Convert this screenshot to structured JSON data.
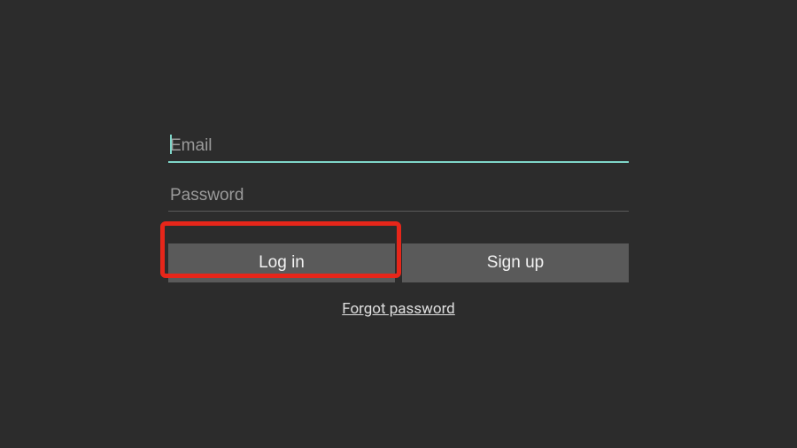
{
  "form": {
    "email_placeholder": "Email",
    "email_value": "",
    "password_placeholder": "Password",
    "password_value": "",
    "login_label": "Log in",
    "signup_label": "Sign up",
    "forgot_label": "Forgot password"
  },
  "colors": {
    "accent": "#7fd6c9",
    "highlight": "#e6261a",
    "button_bg": "#5a5a5a",
    "page_bg": "#2c2c2c"
  }
}
